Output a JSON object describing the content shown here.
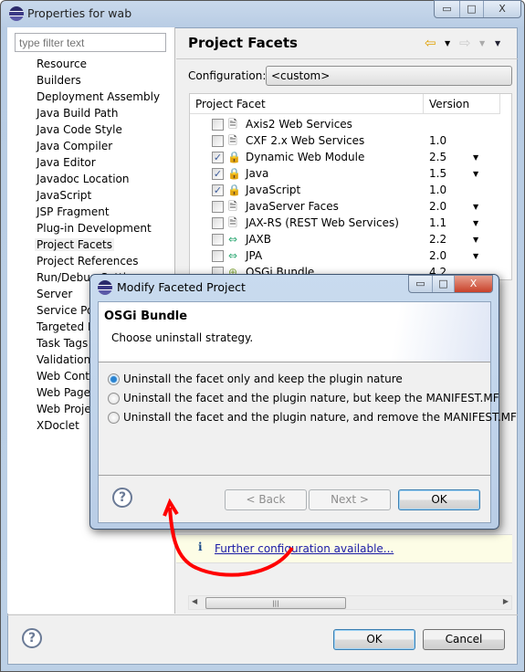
{
  "window": {
    "title": "Properties for wab",
    "controls": {
      "minimize": "▭",
      "maximize": "□",
      "close": "X"
    }
  },
  "sidebar": {
    "filter_placeholder": "type filter text",
    "items": [
      "Resource",
      "Builders",
      "Deployment Assembly",
      "Java Build Path",
      "Java Code Style",
      "Java Compiler",
      "Java Editor",
      "Javadoc Location",
      "JavaScript",
      "JSP Fragment",
      "Plug-in Development",
      "Project Facets",
      "Project References",
      "Run/Debug Settings",
      "Server",
      "Service Pol",
      "Targeted R",
      "Task Tags",
      "Validation",
      "Web Conte",
      "Web Page E",
      "Web Projec",
      "XDoclet"
    ],
    "selected": "Project Facets"
  },
  "main": {
    "title": "Project Facets",
    "configuration_label": "Configuration:",
    "configuration_value": "<custom>",
    "columns": [
      "Project Facet",
      "Version"
    ],
    "facets": [
      {
        "name": "Axis2 Web Services",
        "version": "",
        "checked": false,
        "icon": "document-icon",
        "dropdown": false
      },
      {
        "name": "CXF 2.x Web Services",
        "version": "1.0",
        "checked": false,
        "icon": "document-icon",
        "dropdown": false
      },
      {
        "name": "Dynamic Web Module",
        "version": "2.5",
        "checked": true,
        "icon": "locked-globe-icon",
        "dropdown": true
      },
      {
        "name": "Java",
        "version": "1.5",
        "checked": true,
        "icon": "locked-java-icon",
        "dropdown": true
      },
      {
        "name": "JavaScript",
        "version": "1.0",
        "checked": true,
        "icon": "locked-document-icon",
        "dropdown": false
      },
      {
        "name": "JavaServer Faces",
        "version": "2.0",
        "checked": false,
        "icon": "document-icon",
        "dropdown": true
      },
      {
        "name": "JAX-RS (REST Web Services)",
        "version": "1.1",
        "checked": false,
        "icon": "document-icon",
        "dropdown": true
      },
      {
        "name": "JAXB",
        "version": "2.2",
        "checked": false,
        "icon": "arrows-icon",
        "dropdown": true
      },
      {
        "name": "JPA",
        "version": "2.0",
        "checked": false,
        "icon": "arrows-icon",
        "dropdown": true
      },
      {
        "name": "OSGi Bundle",
        "version": "4.2",
        "checked": false,
        "icon": "bundle-icon",
        "dropdown": false
      }
    ],
    "info_link": "Further configuration available...",
    "ok": "OK",
    "cancel": "Cancel"
  },
  "dialog": {
    "title": "Modify Faceted Project",
    "heading": "OSGi Bundle",
    "subtitle": "Choose uninstall strategy.",
    "options": [
      {
        "label": "Uninstall the facet only and keep the plugin nature",
        "selected": true
      },
      {
        "label": "Uninstall the facet and the plugin nature, but keep the MANIFEST.MF",
        "selected": false
      },
      {
        "label": "Uninstall the facet and the plugin nature, and remove the MANIFEST.MF",
        "selected": false
      }
    ],
    "back": "< Back",
    "next": "Next >",
    "ok": "OK"
  },
  "annotation_color": "#ff0000"
}
